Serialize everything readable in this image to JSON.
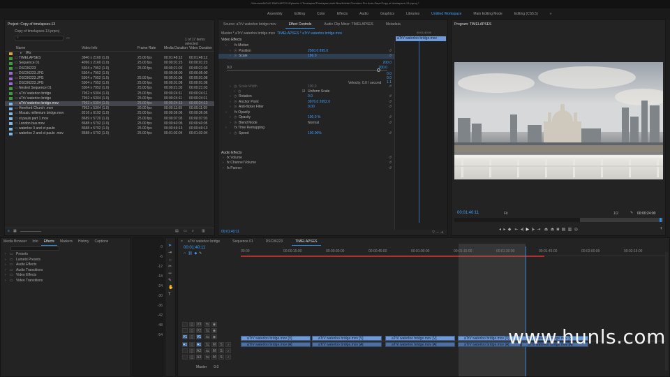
{
  "window": {
    "title": "/Volumes/MOLE RAID/ARTSI /Episode 4 Timelapse/Timelapse work files/Adobe Premiere Pro Auto-Save/Copy of timelapses-13.prproj *"
  },
  "workspaces": [
    "Assembly",
    "Editing",
    "Color",
    "Effects",
    "Audio",
    "Graphics",
    "Libraries",
    "Untitled Workspace",
    "Main Editing Mode",
    "Editing (CS5.5)"
  ],
  "workspace_active": "Untitled Workspace",
  "workspace_more": "»",
  "project": {
    "title": "Project: Copy of timelapses-13",
    "file": "Copy of timelapses-13.prproj",
    "items_selected": "1 of 17 items selected",
    "columns": [
      "Name",
      "Video Info",
      "Frame Rate",
      "Media Duration",
      "Video Duration"
    ],
    "items": [
      {
        "name": "IRs",
        "info": "",
        "rate": "",
        "media": "",
        "video": "",
        "color": "#e0a437",
        "folder": true
      },
      {
        "name": "TIMELAPSES",
        "info": "3840 x 2160 (1.0)",
        "rate": "25.00 fps",
        "media": "00:01:48:12",
        "video": "00:01:48:12",
        "color": "#3f9b3f"
      },
      {
        "name": "Sequence 01",
        "info": "4096 x 2160 (1.0)",
        "rate": "25.00 fps",
        "media": "00:00:01:23",
        "video": "00:00:01:23",
        "color": "#3f9b3f"
      },
      {
        "name": "DSC06223",
        "info": "5304 x 7952 (1.0)",
        "rate": "25.00 fps",
        "media": "00:00:21:03",
        "video": "00:00:21:03",
        "color": "#3f9b3f"
      },
      {
        "name": "DSC06223.JPG",
        "info": "5304 x 7952 (1.0)",
        "rate": "",
        "media": "00:00:05:00",
        "video": "00:00:05:00",
        "color": "#9b6ad6"
      },
      {
        "name": "DSC06223.JPG",
        "info": "5304 x 7952 (1.0)",
        "rate": "25.00 fps",
        "media": "00:00:01:08",
        "video": "00:00:01:08",
        "color": "#9b6ad6"
      },
      {
        "name": "DSC06223.JPG",
        "info": "5304 x 7952 (1.0)",
        "rate": "25.00 fps",
        "media": "00:00:01:08",
        "video": "00:00:01:08",
        "color": "#9b6ad6"
      },
      {
        "name": "Nested Sequence 01",
        "info": "5304 x 7952 (1.0)",
        "rate": "25.00 fps",
        "media": "00:00:21:03",
        "video": "00:00:21:03",
        "color": "#3f9b3f"
      },
      {
        "name": "aTrV waterloo bridge",
        "info": "7952 x 5304 (1.0)",
        "rate": "25.00 fps",
        "media": "00:00:24:11",
        "video": "00:00:24:11",
        "color": "#3f9b3f"
      },
      {
        "name": "aTrV waterloo bridge",
        "info": "7952 x 5304 (1.0)",
        "rate": "25.00 fps",
        "media": "00:00:24:11",
        "video": "00:00:24:11",
        "color": "#3f9b3f"
      },
      {
        "name": "aTrV waterloo bridge.mov",
        "info": "7952 x 5304 (1.0)",
        "rate": "25.00 fps",
        "media": "00:00:24:13",
        "video": "00:00:24:13",
        "color": "#7fb8e6",
        "selected": true
      },
      {
        "name": "Hereford Church .mov",
        "info": "7952 x 5304 (1.0)",
        "rate": "30.00 fps",
        "media": "00:00:11:09",
        "video": "00:00:11:09",
        "color": "#7fb8e6"
      },
      {
        "name": "Mozaic millenium bridge.mov",
        "info": "8216 x 6192 (1.0)",
        "rate": "25.00 fps",
        "media": "00:00:36:06",
        "video": "00:00:36:06",
        "color": "#7fb8e6"
      },
      {
        "name": "st pauls part 1.mov",
        "info": "8689 x 5720 (1.0)",
        "rate": "25.00 fps",
        "media": "00:00:07:03",
        "video": "00:00:07:03",
        "color": "#7fb8e6"
      },
      {
        "name": "London bus.mov",
        "info": "8688 x 5792 (1.0)",
        "rate": "25.00 fps",
        "media": "00:00:40:05",
        "video": "00:00:40:05",
        "color": "#7fb8e6"
      },
      {
        "name": "waterloo 3 and st paulo",
        "info": "8688 x 5792 (1.0)",
        "rate": "25.00 fps",
        "media": "00:00:49:13",
        "video": "00:00:49:13",
        "color": "#7fb8e6"
      },
      {
        "name": "waterloo 2 and st paulo .mov",
        "info": "8688 x 5792 (1.0)",
        "rate": "25.00 fps",
        "media": "00:01:02:04",
        "video": "00:01:02:04",
        "color": "#7fb8e6"
      }
    ]
  },
  "effect_controls": {
    "tabs": [
      "Source: aTrV waterloo bridge.mov",
      "Effect Controls",
      "Audio Clip Mixer: TIMELAPSES",
      "Metadata"
    ],
    "active_tab": "Effect Controls",
    "master": "Master * aTrV waterloo bridge.mov",
    "sequence_clip": "TIMELAPSES * aTrV waterloo bridge.mov",
    "mini_clip": "aTrV waterloo bridge.mov",
    "mini_time": "00:01:40:00",
    "video_effects_label": "Video Effects",
    "audio_effects_label": "Audio Effects",
    "rows": [
      {
        "label": "fx  Motion",
        "indent": 1,
        "value": ""
      },
      {
        "label": "Position",
        "indent": 2,
        "value": "2560.0    895.0"
      },
      {
        "label": "Scale",
        "indent": 2,
        "value": "186.0",
        "highlight": true
      },
      {
        "label": "Scale Width",
        "indent": 2,
        "value": "100.0",
        "dim": true
      },
      {
        "label": "Uniform Scale",
        "indent": 3,
        "value": ""
      },
      {
        "label": "Rotation",
        "indent": 2,
        "value": "0.0"
      },
      {
        "label": "Anchor Point",
        "indent": 2,
        "value": "3976.0    2652.0"
      },
      {
        "label": "Anti-flicker Filter",
        "indent": 2,
        "value": "0.00"
      },
      {
        "label": "fx  Opacity",
        "indent": 1,
        "value": ""
      },
      {
        "label": "Opacity",
        "indent": 2,
        "value": "100.0 %"
      },
      {
        "label": "Blend Mode",
        "indent": 2,
        "value": "Normal"
      },
      {
        "label": "fx  Time Remapping",
        "indent": 1,
        "value": ""
      },
      {
        "label": "Speed",
        "indent": 2,
        "value": "100.00%"
      }
    ],
    "audio_rows": [
      "Volume",
      "Channel Volume",
      "Panner"
    ],
    "graph": {
      "top_value": "200.0",
      "mid_value": "200.0",
      "low_value": "0.0",
      "right_value": "0.0",
      "right_value2": "1.1",
      "min_label": "0.0"
    },
    "velocity": "Velocity: 0.0 / second",
    "footer_time": "00:01:40:11"
  },
  "program": {
    "title": "Program: TIMELAPSES",
    "timecode": "00:01:40:11",
    "fit": "Fit",
    "quality": "1/2",
    "duration": "00:00:24:00"
  },
  "effects_panel": {
    "tabs": [
      "Media Browser",
      "Info",
      "Effects",
      "Markers",
      "History",
      "Captions"
    ],
    "active_tab": "Effects",
    "folders": [
      "Presets",
      "Lumetri Presets",
      "Audio Effects",
      "Audio Transitions",
      "Video Effects",
      "Video Transitions"
    ]
  },
  "timeline": {
    "tabs": [
      "aTrV waterloo bridge",
      "Sequence 01",
      "DSC06223",
      "TIMELAPSES"
    ],
    "active_tab": "TIMELAPSES",
    "timecode": "00:01:40:11",
    "ruler": [
      "00:00",
      "00:00:15:00",
      "00:00:30:00",
      "00:00:45:00",
      "00:01:00:00",
      "00:01:15:00",
      "00:01:30:00",
      "00:01:45:00",
      "00:02:00:00",
      "00:02:15:00"
    ],
    "video_tracks": [
      "V3",
      "V2",
      "V1"
    ],
    "audio_tracks": [
      "A1",
      "A2",
      "A3"
    ],
    "master_label": "Master",
    "master_value": "0.0",
    "clip_label": "aTrV waterloo bridge.mov [V]",
    "audio_clip_label": "aTrV waterloo bridge.mov [A]",
    "meter_scale": [
      "0",
      "-6",
      "-12",
      "-18",
      "-24",
      "-30",
      "-36",
      "-42",
      "-48",
      "-54"
    ]
  },
  "watermark": "www.hunls.com"
}
